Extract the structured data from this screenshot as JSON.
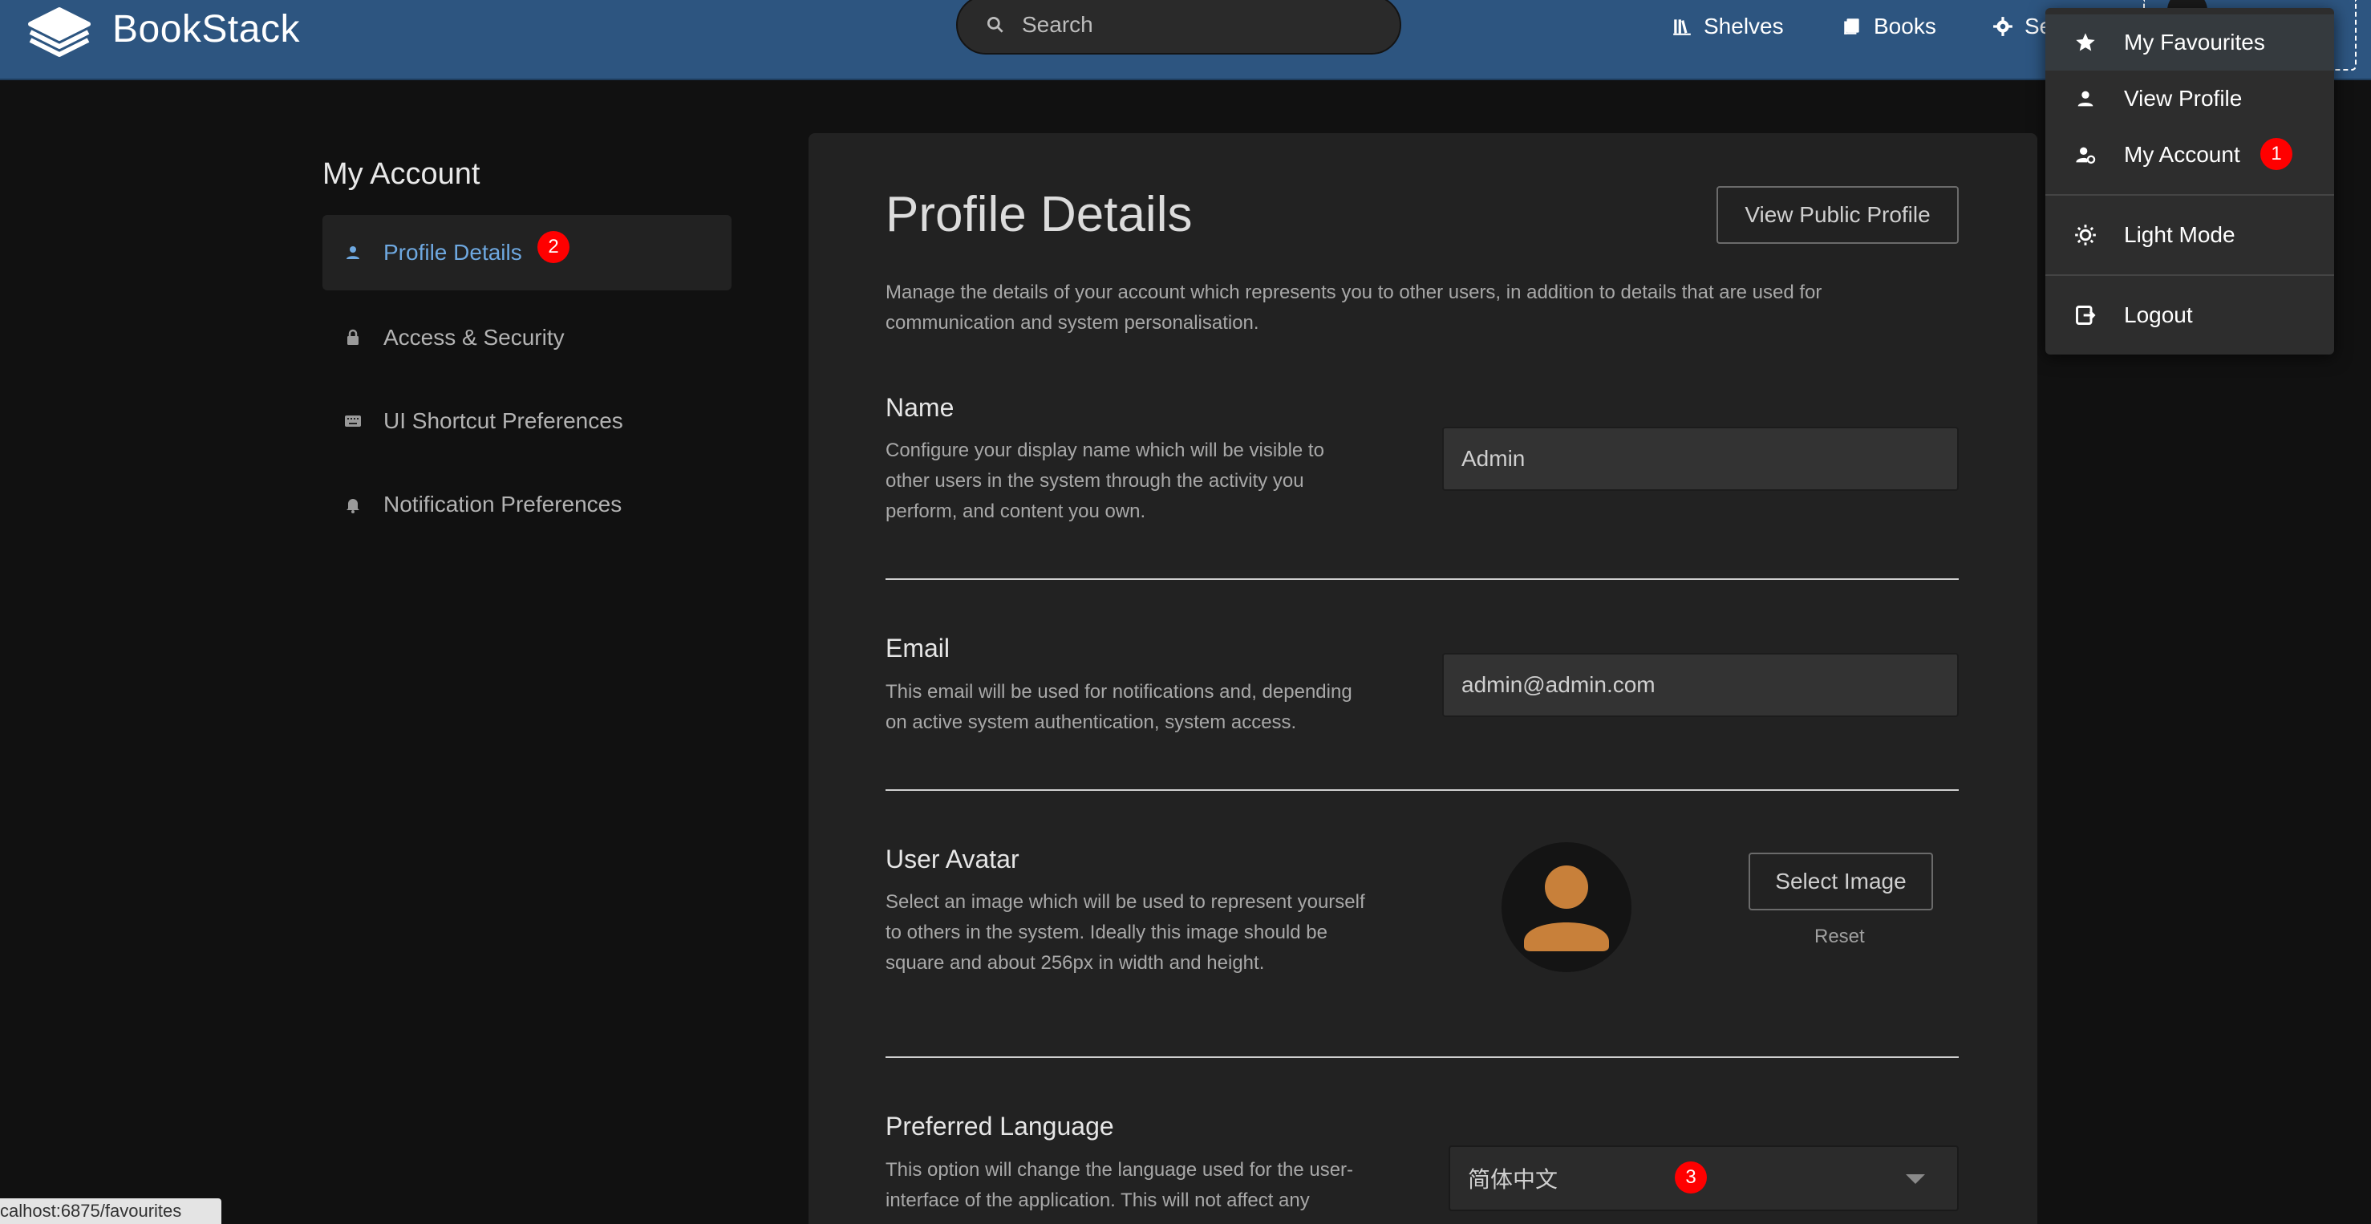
{
  "header": {
    "app_name": "BookStack",
    "search_placeholder": "Search",
    "nav": {
      "shelves": "Shelves",
      "books": "Books",
      "settings": "Se"
    }
  },
  "user_menu": {
    "items": [
      {
        "label": "My Favourites",
        "icon": "star-icon"
      },
      {
        "label": "View Profile",
        "icon": "person-icon"
      },
      {
        "label": "My Account",
        "icon": "user-cog-icon"
      },
      {
        "label": "Light Mode",
        "icon": "sun-icon"
      },
      {
        "label": "Logout",
        "icon": "logout-icon"
      }
    ]
  },
  "badges": {
    "one": "1",
    "two": "2",
    "three": "3"
  },
  "sidebar": {
    "title": "My Account",
    "items": [
      {
        "label": "Profile Details",
        "icon": "person-icon"
      },
      {
        "label": "Access & Security",
        "icon": "lock-icon"
      },
      {
        "label": "UI Shortcut Preferences",
        "icon": "keyboard-icon"
      },
      {
        "label": "Notification Preferences",
        "icon": "bell-icon"
      }
    ]
  },
  "main": {
    "title": "Profile Details",
    "view_public_profile": "View Public Profile",
    "intro_line1": "Manage the details of your account which represents you to other users, in addition to details that are used for",
    "intro_line2": "communication and system personalisation.",
    "name": {
      "title": "Name",
      "desc_lines": [
        "Configure your display name which will be visible to",
        "other users in the system through the activity you",
        "perform, and content you own."
      ],
      "value": "Admin"
    },
    "email": {
      "title": "Email",
      "desc_lines": [
        "This email will be used for notifications and, depending",
        "on active system authentication, system access."
      ],
      "value": "admin@admin.com"
    },
    "avatar": {
      "title": "User Avatar",
      "desc_lines": [
        "Select an image which will be used to represent yourself",
        "to others in the system. Ideally this image should be",
        "square and about 256px in width and height."
      ],
      "select_label": "Select Image",
      "reset_label": "Reset"
    },
    "language": {
      "title": "Preferred Language",
      "desc_lines": [
        "This option will change the language used for the user-",
        "interface of the application. This will not affect any"
      ],
      "selected": "简体中文"
    }
  },
  "statusbar": {
    "url": "calhost:6875/favourites"
  },
  "colors": {
    "header_bg": "#2d5580",
    "page_bg": "#111111",
    "card_bg": "#222222",
    "accent": "#6ea8e0",
    "badge": "#ff0000",
    "avatar_fill": "#c8803a"
  }
}
